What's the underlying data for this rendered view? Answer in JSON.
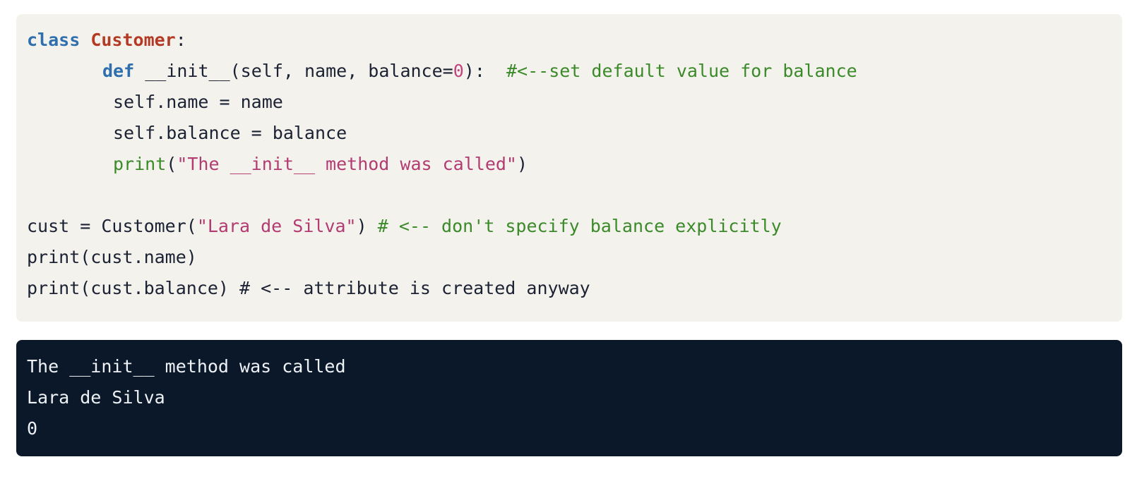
{
  "colors": {
    "code_background": "#f4f2ec",
    "output_background": "#0a1829",
    "keyword": "#2f6fae",
    "class_name": "#b33a25",
    "string": "#b23b72",
    "number": "#c0467f",
    "comment": "#3b8a2a",
    "text": "#1b2233",
    "output_text": "#eef1f5"
  },
  "code": {
    "line1": {
      "kw": "class",
      "name": "Customer",
      "rest": ":"
    },
    "line2": {
      "kw": "def",
      "sig_start": "__init__(self, name, balance=",
      "num": "0",
      "sig_end": "):",
      "comment": "#<--set default value for balance"
    },
    "line3": "self.name = name",
    "line4": "self.balance = balance",
    "line5": {
      "fn": "print",
      "open": "(",
      "str": "\"The __init__ method was called\"",
      "close": ")"
    },
    "line7": {
      "start": "cust = Customer(",
      "str": "\"Lara de Silva\"",
      "end": ")",
      "comment": "# <-- don't specify balance explicitly"
    },
    "line8": "print(cust.name)",
    "line9": "print(cust.balance) # <-- attribute is created anyway"
  },
  "output": {
    "lines": [
      "The __init__ method was called",
      "Lara de Silva",
      "0"
    ]
  }
}
